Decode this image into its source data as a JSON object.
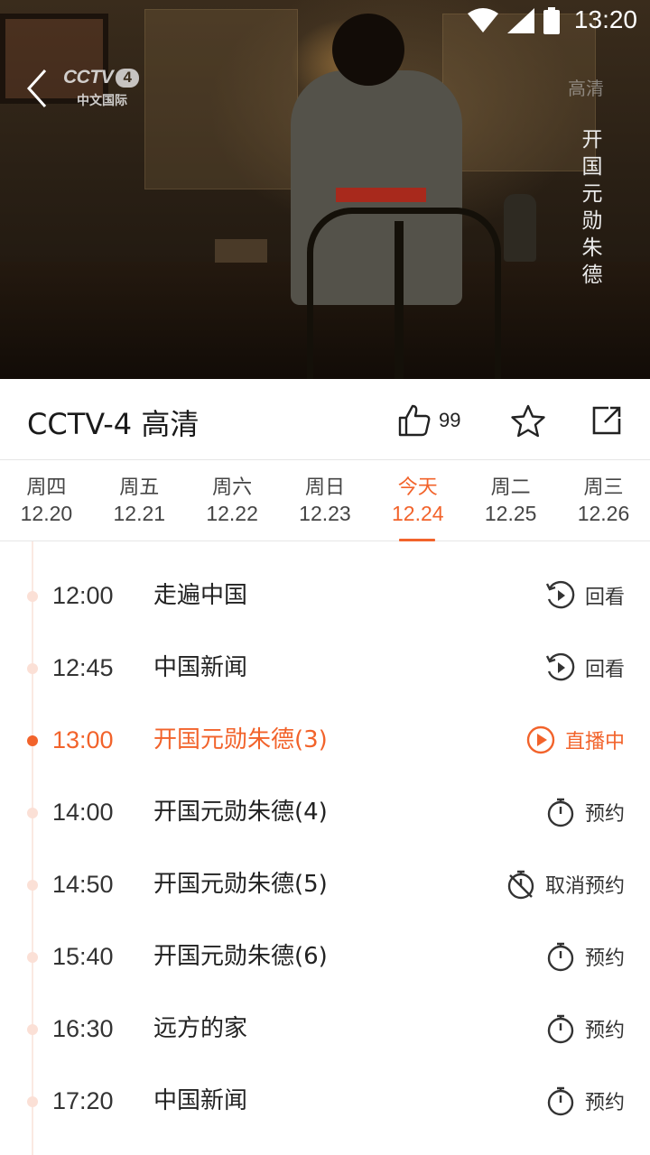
{
  "status_bar": {
    "time": "13:20"
  },
  "player": {
    "logo": {
      "brand": "CCTV",
      "channel_number": "4",
      "sub": "中文国际"
    },
    "quality": "高清",
    "subtitle": "开国元勋朱德"
  },
  "channel": {
    "title": "CCTV-4 高清",
    "likes": "99"
  },
  "date_tabs": [
    {
      "weekday": "周四",
      "date": "12.20"
    },
    {
      "weekday": "周五",
      "date": "12.21"
    },
    {
      "weekday": "周六",
      "date": "12.22"
    },
    {
      "weekday": "周日",
      "date": "12.23"
    },
    {
      "weekday": "今天",
      "date": "12.24",
      "active": true
    },
    {
      "weekday": "周二",
      "date": "12.25"
    },
    {
      "weekday": "周三",
      "date": "12.26"
    }
  ],
  "schedule": [
    {
      "time": "12:00",
      "title": "走遍中国",
      "action": "回看",
      "icon": "replay-icon"
    },
    {
      "time": "12:45",
      "title": "中国新闻",
      "action": "回看",
      "icon": "replay-icon"
    },
    {
      "time": "13:00",
      "title": "开国元勋朱德(3)",
      "action": "直播中",
      "icon": "play-circle-icon",
      "live": true
    },
    {
      "time": "14:00",
      "title": "开国元勋朱德(4)",
      "action": "预约",
      "icon": "stopwatch-icon"
    },
    {
      "time": "14:50",
      "title": "开国元勋朱德(5)",
      "action": "取消预约",
      "icon": "stopwatch-cancel-icon"
    },
    {
      "time": "15:40",
      "title": "开国元勋朱德(6)",
      "action": "预约",
      "icon": "stopwatch-icon"
    },
    {
      "time": "16:30",
      "title": "远方的家",
      "action": "预约",
      "icon": "stopwatch-icon"
    },
    {
      "time": "17:20",
      "title": "中国新闻",
      "action": "预约",
      "icon": "stopwatch-icon"
    }
  ],
  "colors": {
    "accent": "#f2632b",
    "timeline": "#fbe9e2"
  }
}
